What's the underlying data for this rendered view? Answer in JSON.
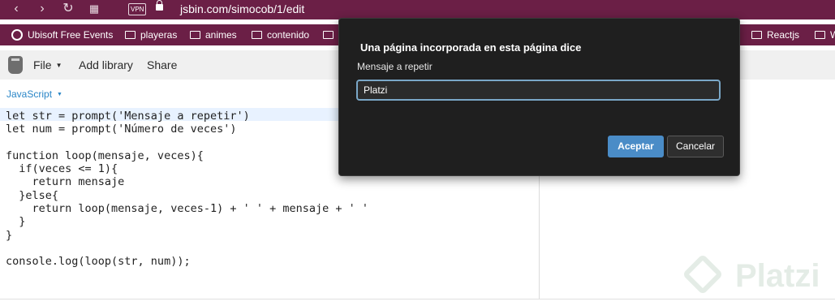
{
  "browser": {
    "url": "jsbin.com/simocob/1/edit",
    "vpn_label": "VPN",
    "bookmarks": [
      "Ubisoft Free Events",
      "playeras",
      "animes",
      "contenido",
      "Reactjs",
      "W"
    ]
  },
  "toolbar": {
    "file_label": "File",
    "add_library_label": "Add library",
    "share_label": "Share"
  },
  "editor": {
    "language": "JavaScript",
    "code_lines": [
      "let str = prompt('Mensaje a repetir')",
      "let num = prompt('Número de veces')",
      "",
      "function loop(mensaje, veces){",
      "  if(veces <= 1){",
      "    return mensaje",
      "  }else{",
      "    return loop(mensaje, veces-1) + ' ' + mensaje + ' '",
      "  }",
      "}",
      "",
      "console.log(loop(str, num));"
    ]
  },
  "dialog": {
    "title": "Una página incorporada en esta página dice",
    "prompt": "Mensaje a repetir",
    "input_value": "Platzi",
    "ok_label": "Aceptar",
    "cancel_label": "Cancelar"
  },
  "watermark": {
    "text": "Platzi"
  },
  "colors": {
    "browser_bar": "#6b1f46",
    "dialog_bg": "#1f1f1f",
    "accent": "#4a8cc7"
  }
}
